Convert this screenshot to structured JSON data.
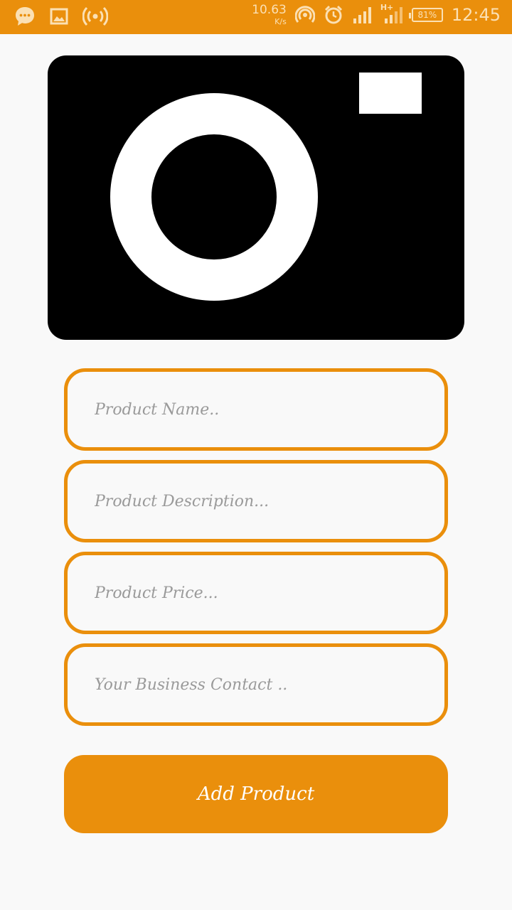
{
  "status_bar": {
    "net_speed_value": "10.63",
    "net_speed_unit": "K/s",
    "network_type": "H+",
    "battery": "81%",
    "time": "12:45",
    "icons": [
      "message-icon",
      "image-icon",
      "hotspot-icon",
      "wifi-icon",
      "alarm-icon",
      "signal-icon",
      "signal-icon",
      "battery-icon"
    ]
  },
  "product_image": {
    "icon": "camera-icon"
  },
  "form": {
    "product_name_placeholder": "Product Name..",
    "product_description_placeholder": "Product Description...",
    "product_price_placeholder": "Product Price...",
    "business_contact_placeholder": "Your Business Contact .."
  },
  "add_button_label": "Add Product",
  "colors": {
    "accent": "#ea8f0c",
    "background": "#f9f9f9"
  }
}
